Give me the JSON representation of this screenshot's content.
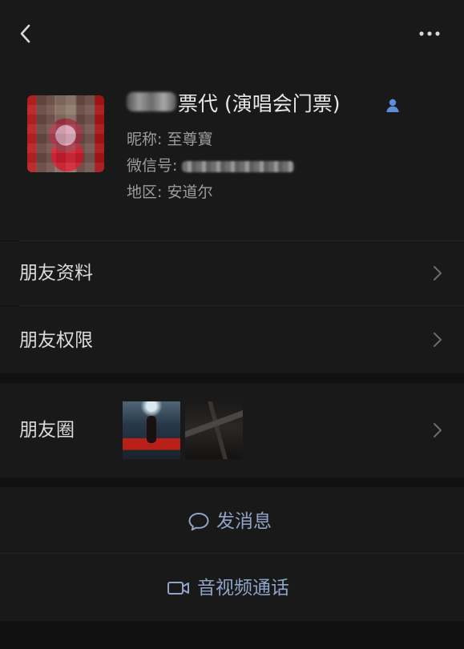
{
  "nav": {
    "back_icon": "chevron-left-icon",
    "more_icon": "more-dots-icon"
  },
  "profile": {
    "name": "票代 (演唱会门票)",
    "nickname": "昵称: 至尊寶",
    "wechat_id_label": "微信号:",
    "region": "地区: 安道尔",
    "friend_badge_icon": "person-icon",
    "colors": {
      "name": "#e8e8e8",
      "secondary": "#9c9c9c",
      "badge": "#5a8fd8"
    }
  },
  "rows": {
    "friend_info": "朋友资料",
    "friend_permissions": "朋友权限",
    "moments": "朋友圈"
  },
  "actions": {
    "message": "发消息",
    "av_call": "音视频通话",
    "message_icon": "message-bubble-icon",
    "video_icon": "video-camera-icon",
    "color": "#8fa4c7"
  }
}
